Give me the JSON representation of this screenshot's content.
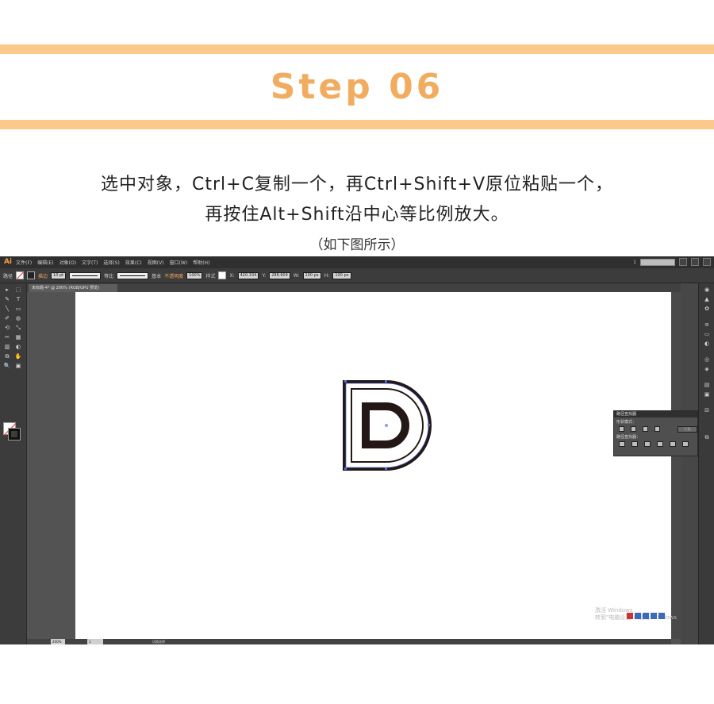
{
  "header": {
    "title": "Step 06",
    "description_line1": "选中对象，Ctrl+C复制一个，再Ctrl+Shift+V原位粘贴一个，",
    "description_line2": "再按住Alt+Shift沿中心等比例放大。",
    "caption": "（如下图所示）"
  },
  "colors": {
    "band": "#fbc98c",
    "title": "#f2ac5f",
    "ai_accent": "#f7a23b",
    "letter_stroke": "#231815",
    "selection": "#4f6bd6"
  },
  "illustrator": {
    "logo": "Ai",
    "menu": [
      "文件(F)",
      "编辑(E)",
      "对象(O)",
      "文字(T)",
      "选择(S)",
      "效果(C)",
      "视图(V)",
      "窗口(W)",
      "帮助(H)"
    ],
    "workspace_number": "1",
    "control_bar": {
      "mode_label": "路径",
      "stroke_label": "描边",
      "stroke_weight": "10 pt",
      "profile_label": "等比",
      "brush_label": "基本",
      "opacity_label": "不透明度",
      "opacity_value": "100%",
      "style_label": "样式",
      "x_value": "420.334",
      "y_value": "288.604",
      "w_value": "100 px",
      "h_value": "100 px"
    },
    "doc_tab": "未标题-4* @ 200% (RGB/GPU 预览)",
    "tools": [
      "▸",
      "⬚",
      "✎",
      "T",
      "╲",
      "▭",
      "✐",
      "◍",
      "⟲",
      "⤡",
      "✂",
      "▦",
      "▥",
      "◐",
      "⧉",
      "✋",
      "🔍",
      "▣"
    ],
    "status_bar": {
      "zoom": "200%",
      "page": "1",
      "mode": "切换选择"
    },
    "pathfinder_panel": {
      "title": "路径查找器",
      "shape_modes_label": "形状模式：",
      "pathfinders_label": "路径查找器：",
      "expand_label": "扩展"
    },
    "dock_icons": [
      "palette-icon",
      "brush-icon",
      "symbol-icon",
      "stroke-icon",
      "gradient-icon",
      "transparency-icon",
      "appearance-icon",
      "graphic-style-icon",
      "layers-icon",
      "artboard-icon",
      "align-icon",
      "transform-icon"
    ],
    "watermark_line1": "激活 Windows",
    "watermark_line2": "转到\"电脑设置\"以激活 Windows"
  }
}
